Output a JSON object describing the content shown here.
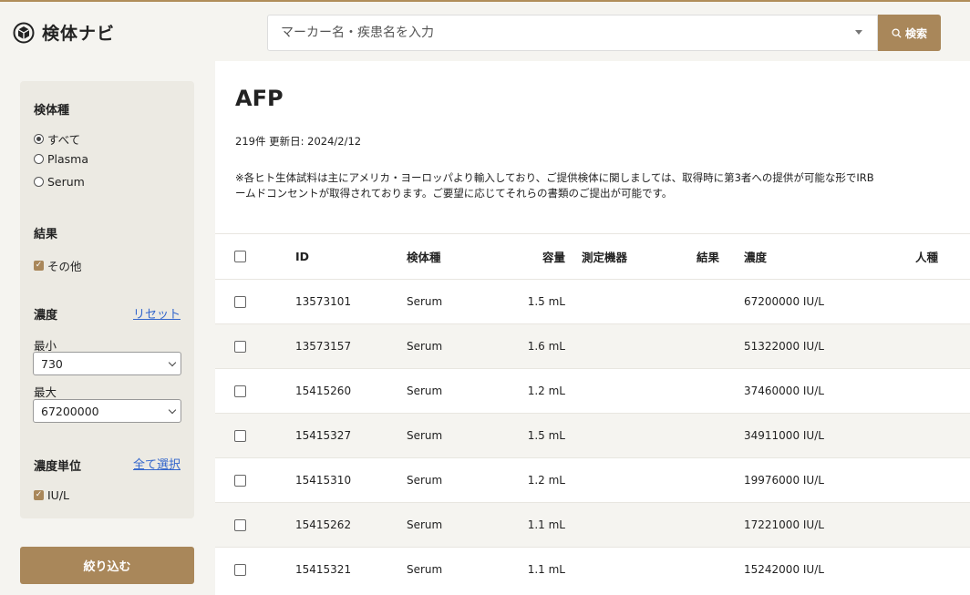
{
  "header": {
    "logo_text": "検体ナビ",
    "search_placeholder": "マーカー名・疾患名を入力",
    "search_button": "検索"
  },
  "sidebar": {
    "specimen_type": {
      "title": "検体種",
      "options": [
        {
          "label": "すべて",
          "selected": true
        },
        {
          "label": "Plasma",
          "selected": false
        },
        {
          "label": "Serum",
          "selected": false
        }
      ]
    },
    "result": {
      "title": "結果",
      "options": [
        {
          "label": "その他",
          "checked": true
        }
      ]
    },
    "concentration": {
      "title": "濃度",
      "reset_label": "リセット",
      "min_label": "最小",
      "min_value": "730",
      "max_label": "最大",
      "max_value": "67200000"
    },
    "unit": {
      "title": "濃度単位",
      "select_all_label": "全て選択",
      "options": [
        {
          "label": "IU/L",
          "checked": true
        }
      ]
    },
    "filter_button": "絞り込む"
  },
  "main": {
    "title": "AFP",
    "meta": "219件 更新日: 2024/2/12",
    "notice_line1": "※各ヒト生体試料は主にアメリカ・ヨーロッパより輸入しており、ご提供検体に関しましては、取得時に第3者への提供が可能な形でIRB",
    "notice_line2": "ームドコンセントが取得されております。ご要望に応じてそれらの書類のご提出が可能です。",
    "columns": {
      "id": "ID",
      "type": "検体種",
      "volume": "容量",
      "instrument": "測定機器",
      "result": "結果",
      "concentration": "濃度",
      "race": "人種"
    },
    "rows": [
      {
        "id": "13573101",
        "type": "Serum",
        "volume": "1.5 mL",
        "concentration": "67200000 IU/L"
      },
      {
        "id": "13573157",
        "type": "Serum",
        "volume": "1.6 mL",
        "concentration": "51322000 IU/L"
      },
      {
        "id": "15415260",
        "type": "Serum",
        "volume": "1.2 mL",
        "concentration": "37460000 IU/L"
      },
      {
        "id": "15415327",
        "type": "Serum",
        "volume": "1.5 mL",
        "concentration": "34911000 IU/L"
      },
      {
        "id": "15415310",
        "type": "Serum",
        "volume": "1.2 mL",
        "concentration": "19976000 IU/L"
      },
      {
        "id": "15415262",
        "type": "Serum",
        "volume": "1.1 mL",
        "concentration": "17221000 IU/L"
      },
      {
        "id": "15415321",
        "type": "Serum",
        "volume": "1.1 mL",
        "concentration": "15242000 IU/L"
      }
    ]
  },
  "colors": {
    "accent": "#a9875a",
    "link": "#3366cc",
    "sidebar_bg": "#eceae3",
    "row_alt": "#f5f4f0"
  }
}
